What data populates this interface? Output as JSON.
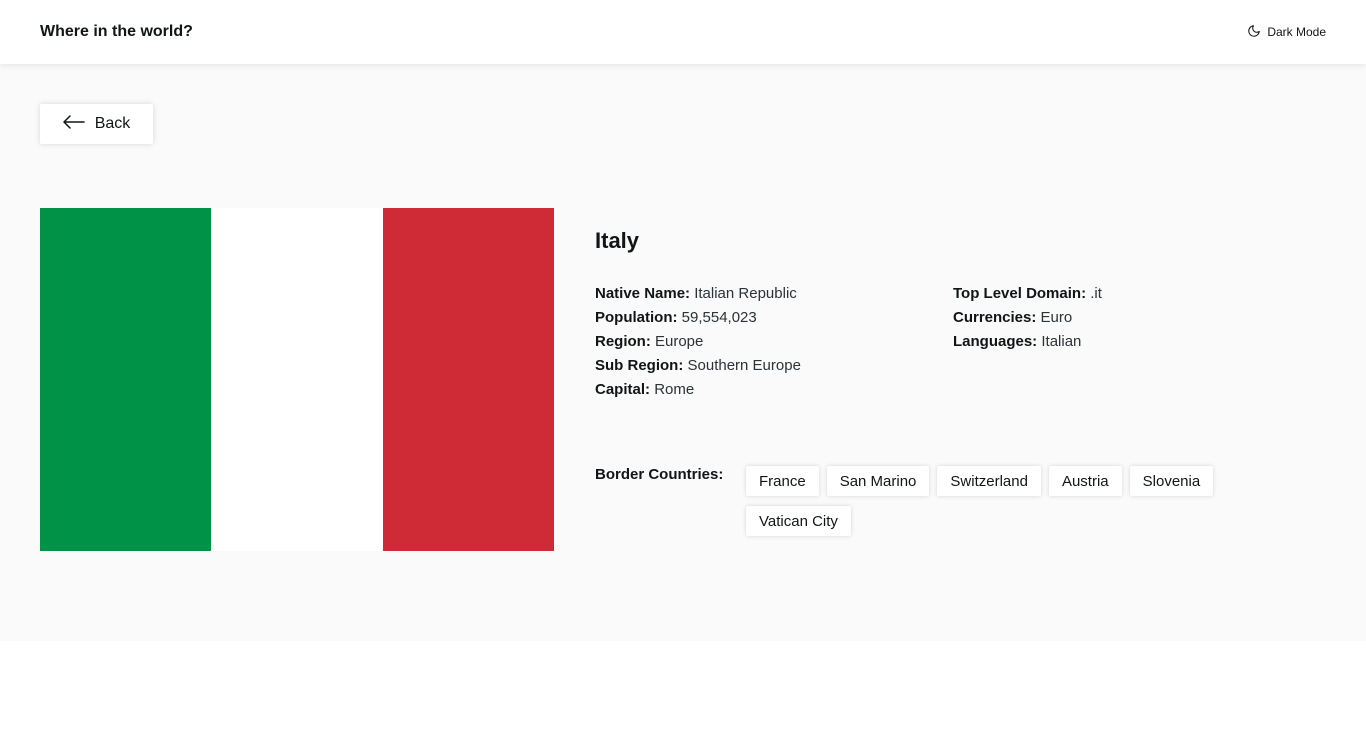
{
  "header": {
    "title": "Where in the world?",
    "mode_label": "Dark Mode",
    "mode_icon": "moon-icon"
  },
  "back": {
    "label": "Back",
    "icon": "arrow-left-icon"
  },
  "flag": {
    "colors": [
      "#009246",
      "#ffffff",
      "#ce2b37"
    ]
  },
  "country": {
    "name": "Italy",
    "left": [
      {
        "label": "Native Name:",
        "value": "Italian Republic"
      },
      {
        "label": "Population:",
        "value": "59,554,023"
      },
      {
        "label": "Region:",
        "value": "Europe"
      },
      {
        "label": "Sub Region:",
        "value": "Southern Europe"
      },
      {
        "label": "Capital:",
        "value": "Rome"
      }
    ],
    "right": [
      {
        "label": "Top Level Domain:",
        "value": ".it"
      },
      {
        "label": "Currencies:",
        "value": "Euro"
      },
      {
        "label": "Languages:",
        "value": "Italian"
      }
    ],
    "borders_label": "Border Countries:",
    "borders": [
      "France",
      "San Marino",
      "Switzerland",
      "Austria",
      "Slovenia",
      "Vatican City"
    ]
  }
}
